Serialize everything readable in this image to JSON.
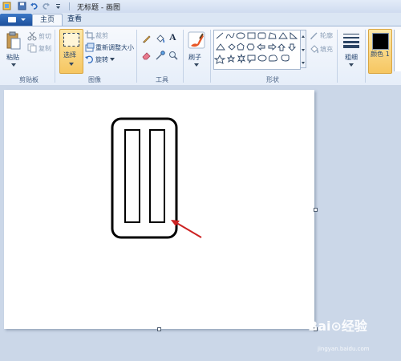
{
  "window": {
    "title": "无标题 - 画图"
  },
  "tabs": [
    {
      "label": "主页"
    },
    {
      "label": "查看"
    }
  ],
  "ribbon": {
    "clipboard": {
      "paste": "粘贴",
      "cut": "剪切",
      "copy": "复制",
      "group": "剪贴板"
    },
    "image": {
      "select": "选择",
      "crop": "裁剪",
      "resize": "重新调整大小",
      "rotate": "旋转",
      "group": "图像"
    },
    "tools": {
      "group": "工具",
      "text_tool": "A"
    },
    "brushes": {
      "label": "刷子"
    },
    "shapes": {
      "outline": "轮廓",
      "fill": "填充",
      "group": "形状"
    },
    "size": {
      "label": "粗细"
    },
    "colors": {
      "color1": "颜色 1",
      "color1_value": "#000000"
    }
  },
  "watermark": {
    "text": "Bai⊙经验",
    "sub": "jingyan.baidu.com"
  },
  "colors": {
    "ribbon_bg": "#e6eef9",
    "canvas_bg": "#ffffff",
    "work_bg": "#cbd7e8",
    "arrow": "#cc2222"
  }
}
